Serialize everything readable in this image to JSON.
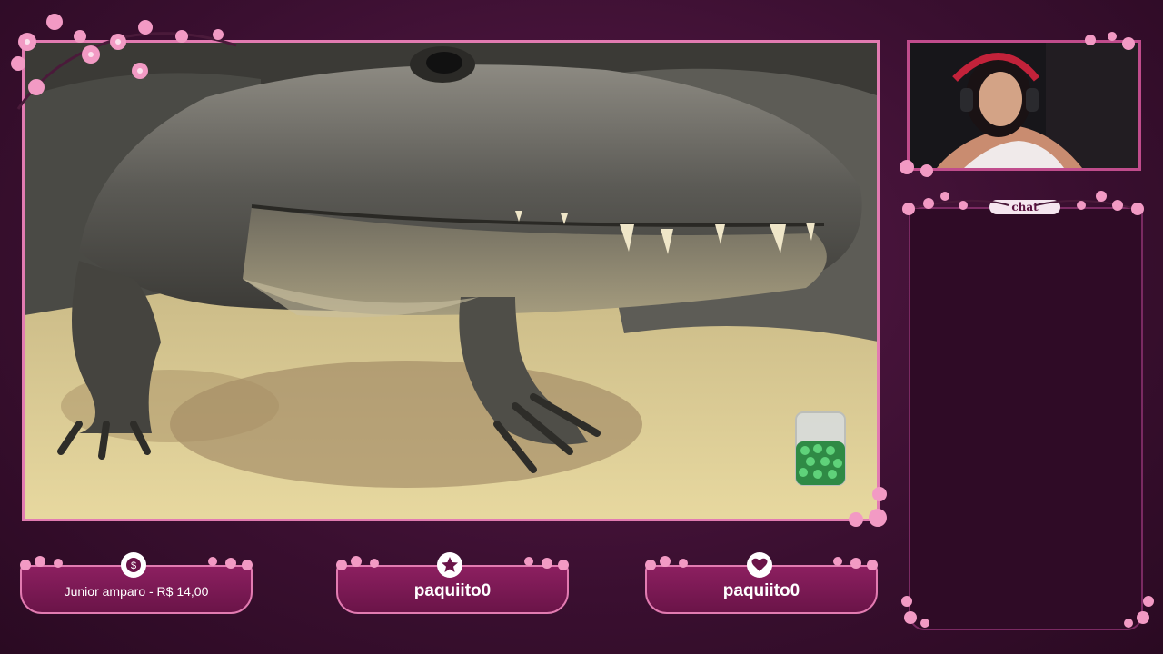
{
  "chat": {
    "tab_label": "chat"
  },
  "alerts": {
    "donation": {
      "text": "Junior amparo - R$ 14,00",
      "icon": "dollar-icon"
    },
    "follow": {
      "text": "paquiito0",
      "icon": "star-icon"
    },
    "sub": {
      "text": "paquiito0",
      "icon": "heart-icon"
    }
  },
  "colors": {
    "background": "#3a0f30",
    "frame_border": "#e27bb1",
    "alert_fill": "#7a1a54",
    "chat_panel": "#2f0b26",
    "blossom": "#f29ac4"
  }
}
